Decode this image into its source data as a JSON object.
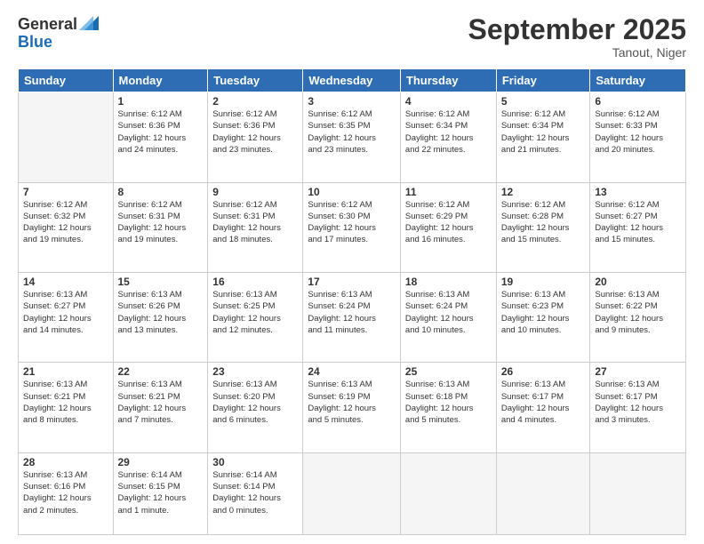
{
  "header": {
    "logo_general": "General",
    "logo_blue": "Blue",
    "month": "September 2025",
    "location": "Tanout, Niger"
  },
  "days": [
    "Sunday",
    "Monday",
    "Tuesday",
    "Wednesday",
    "Thursday",
    "Friday",
    "Saturday"
  ],
  "weeks": [
    [
      {
        "date": "",
        "info": ""
      },
      {
        "date": "1",
        "info": "Sunrise: 6:12 AM\nSunset: 6:36 PM\nDaylight: 12 hours\nand 24 minutes."
      },
      {
        "date": "2",
        "info": "Sunrise: 6:12 AM\nSunset: 6:36 PM\nDaylight: 12 hours\nand 23 minutes."
      },
      {
        "date": "3",
        "info": "Sunrise: 6:12 AM\nSunset: 6:35 PM\nDaylight: 12 hours\nand 23 minutes."
      },
      {
        "date": "4",
        "info": "Sunrise: 6:12 AM\nSunset: 6:34 PM\nDaylight: 12 hours\nand 22 minutes."
      },
      {
        "date": "5",
        "info": "Sunrise: 6:12 AM\nSunset: 6:34 PM\nDaylight: 12 hours\nand 21 minutes."
      },
      {
        "date": "6",
        "info": "Sunrise: 6:12 AM\nSunset: 6:33 PM\nDaylight: 12 hours\nand 20 minutes."
      }
    ],
    [
      {
        "date": "7",
        "info": "Sunrise: 6:12 AM\nSunset: 6:32 PM\nDaylight: 12 hours\nand 19 minutes."
      },
      {
        "date": "8",
        "info": "Sunrise: 6:12 AM\nSunset: 6:31 PM\nDaylight: 12 hours\nand 19 minutes."
      },
      {
        "date": "9",
        "info": "Sunrise: 6:12 AM\nSunset: 6:31 PM\nDaylight: 12 hours\nand 18 minutes."
      },
      {
        "date": "10",
        "info": "Sunrise: 6:12 AM\nSunset: 6:30 PM\nDaylight: 12 hours\nand 17 minutes."
      },
      {
        "date": "11",
        "info": "Sunrise: 6:12 AM\nSunset: 6:29 PM\nDaylight: 12 hours\nand 16 minutes."
      },
      {
        "date": "12",
        "info": "Sunrise: 6:12 AM\nSunset: 6:28 PM\nDaylight: 12 hours\nand 15 minutes."
      },
      {
        "date": "13",
        "info": "Sunrise: 6:12 AM\nSunset: 6:27 PM\nDaylight: 12 hours\nand 15 minutes."
      }
    ],
    [
      {
        "date": "14",
        "info": "Sunrise: 6:13 AM\nSunset: 6:27 PM\nDaylight: 12 hours\nand 14 minutes."
      },
      {
        "date": "15",
        "info": "Sunrise: 6:13 AM\nSunset: 6:26 PM\nDaylight: 12 hours\nand 13 minutes."
      },
      {
        "date": "16",
        "info": "Sunrise: 6:13 AM\nSunset: 6:25 PM\nDaylight: 12 hours\nand 12 minutes."
      },
      {
        "date": "17",
        "info": "Sunrise: 6:13 AM\nSunset: 6:24 PM\nDaylight: 12 hours\nand 11 minutes."
      },
      {
        "date": "18",
        "info": "Sunrise: 6:13 AM\nSunset: 6:24 PM\nDaylight: 12 hours\nand 10 minutes."
      },
      {
        "date": "19",
        "info": "Sunrise: 6:13 AM\nSunset: 6:23 PM\nDaylight: 12 hours\nand 10 minutes."
      },
      {
        "date": "20",
        "info": "Sunrise: 6:13 AM\nSunset: 6:22 PM\nDaylight: 12 hours\nand 9 minutes."
      }
    ],
    [
      {
        "date": "21",
        "info": "Sunrise: 6:13 AM\nSunset: 6:21 PM\nDaylight: 12 hours\nand 8 minutes."
      },
      {
        "date": "22",
        "info": "Sunrise: 6:13 AM\nSunset: 6:21 PM\nDaylight: 12 hours\nand 7 minutes."
      },
      {
        "date": "23",
        "info": "Sunrise: 6:13 AM\nSunset: 6:20 PM\nDaylight: 12 hours\nand 6 minutes."
      },
      {
        "date": "24",
        "info": "Sunrise: 6:13 AM\nSunset: 6:19 PM\nDaylight: 12 hours\nand 5 minutes."
      },
      {
        "date": "25",
        "info": "Sunrise: 6:13 AM\nSunset: 6:18 PM\nDaylight: 12 hours\nand 5 minutes."
      },
      {
        "date": "26",
        "info": "Sunrise: 6:13 AM\nSunset: 6:17 PM\nDaylight: 12 hours\nand 4 minutes."
      },
      {
        "date": "27",
        "info": "Sunrise: 6:13 AM\nSunset: 6:17 PM\nDaylight: 12 hours\nand 3 minutes."
      }
    ],
    [
      {
        "date": "28",
        "info": "Sunrise: 6:13 AM\nSunset: 6:16 PM\nDaylight: 12 hours\nand 2 minutes."
      },
      {
        "date": "29",
        "info": "Sunrise: 6:14 AM\nSunset: 6:15 PM\nDaylight: 12 hours\nand 1 minute."
      },
      {
        "date": "30",
        "info": "Sunrise: 6:14 AM\nSunset: 6:14 PM\nDaylight: 12 hours\nand 0 minutes."
      },
      {
        "date": "",
        "info": ""
      },
      {
        "date": "",
        "info": ""
      },
      {
        "date": "",
        "info": ""
      },
      {
        "date": "",
        "info": ""
      }
    ]
  ]
}
